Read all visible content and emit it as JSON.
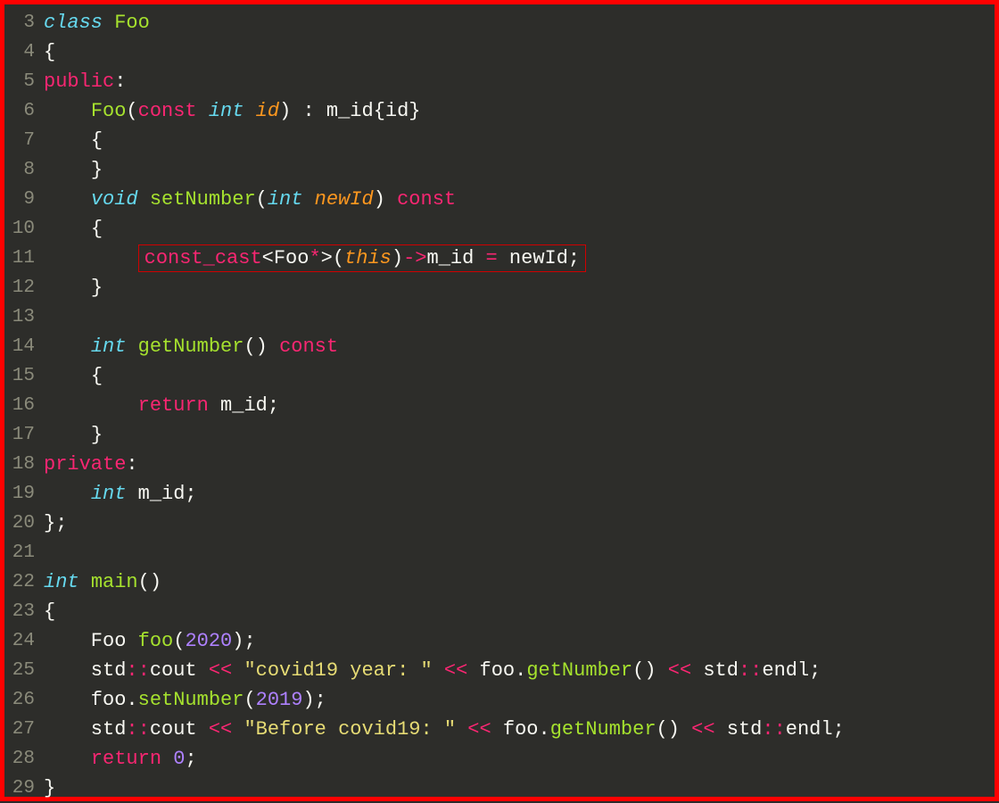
{
  "lines": [
    {
      "num": "3",
      "tokens": [
        [
          "kw-class",
          "class"
        ],
        [
          "ident",
          " "
        ],
        [
          "classname",
          "Foo"
        ]
      ]
    },
    {
      "num": "4",
      "tokens": [
        [
          "punct",
          "{"
        ]
      ]
    },
    {
      "num": "5",
      "tokens": [
        [
          "kw-access",
          "public"
        ],
        [
          "punct",
          ":"
        ]
      ]
    },
    {
      "num": "6",
      "tokens": [
        [
          "ident",
          "    "
        ],
        [
          "funcname",
          "Foo"
        ],
        [
          "punct",
          "("
        ],
        [
          "kw-const",
          "const"
        ],
        [
          "ident",
          " "
        ],
        [
          "kw-type",
          "int"
        ],
        [
          "ident",
          " "
        ],
        [
          "param",
          "id"
        ],
        [
          "punct",
          ") : "
        ],
        [
          "ident",
          "m_id"
        ],
        [
          "punct",
          "{"
        ],
        [
          "ident",
          "id"
        ],
        [
          "punct",
          "}"
        ]
      ]
    },
    {
      "num": "7",
      "tokens": [
        [
          "ident",
          "    "
        ],
        [
          "punct",
          "{"
        ]
      ]
    },
    {
      "num": "8",
      "tokens": [
        [
          "ident",
          "    "
        ],
        [
          "punct",
          "}"
        ]
      ]
    },
    {
      "num": "9",
      "tokens": [
        [
          "ident",
          "    "
        ],
        [
          "kw-type",
          "void"
        ],
        [
          "ident",
          " "
        ],
        [
          "funcname",
          "setNumber"
        ],
        [
          "punct",
          "("
        ],
        [
          "kw-type",
          "int"
        ],
        [
          "ident",
          " "
        ],
        [
          "param",
          "newId"
        ],
        [
          "punct",
          ") "
        ],
        [
          "kw-const",
          "const"
        ]
      ]
    },
    {
      "num": "10",
      "tokens": [
        [
          "ident",
          "    "
        ],
        [
          "punct",
          "{"
        ]
      ]
    },
    {
      "num": "11",
      "highlight": true,
      "prefix": "        ",
      "tokens": [
        [
          "kw-cast",
          "const_cast"
        ],
        [
          "punct",
          "<"
        ],
        [
          "ident",
          "Foo"
        ],
        [
          "op-red",
          "*"
        ],
        [
          "punct",
          ">("
        ],
        [
          "kw-this",
          "this"
        ],
        [
          "punct",
          ")"
        ],
        [
          "op-red",
          "->"
        ],
        [
          "ident",
          "m_id "
        ],
        [
          "op-red",
          "="
        ],
        [
          "ident",
          " newId;"
        ]
      ]
    },
    {
      "num": "12",
      "tokens": [
        [
          "ident",
          "    "
        ],
        [
          "punct",
          "}"
        ]
      ]
    },
    {
      "num": "13",
      "tokens": []
    },
    {
      "num": "14",
      "tokens": [
        [
          "ident",
          "    "
        ],
        [
          "kw-type",
          "int"
        ],
        [
          "ident",
          " "
        ],
        [
          "funcname",
          "getNumber"
        ],
        [
          "punct",
          "() "
        ],
        [
          "kw-const",
          "const"
        ]
      ]
    },
    {
      "num": "15",
      "tokens": [
        [
          "ident",
          "    "
        ],
        [
          "punct",
          "{"
        ]
      ]
    },
    {
      "num": "16",
      "tokens": [
        [
          "ident",
          "        "
        ],
        [
          "kw-return",
          "return"
        ],
        [
          "ident",
          " m_id;"
        ]
      ]
    },
    {
      "num": "17",
      "tokens": [
        [
          "ident",
          "    "
        ],
        [
          "punct",
          "}"
        ]
      ]
    },
    {
      "num": "18",
      "tokens": [
        [
          "kw-access",
          "private"
        ],
        [
          "punct",
          ":"
        ]
      ]
    },
    {
      "num": "19",
      "tokens": [
        [
          "ident",
          "    "
        ],
        [
          "kw-type",
          "int"
        ],
        [
          "ident",
          " m_id;"
        ]
      ]
    },
    {
      "num": "20",
      "tokens": [
        [
          "punct",
          "};"
        ]
      ]
    },
    {
      "num": "21",
      "tokens": []
    },
    {
      "num": "22",
      "tokens": [
        [
          "kw-type",
          "int"
        ],
        [
          "ident",
          " "
        ],
        [
          "funcname",
          "main"
        ],
        [
          "punct",
          "()"
        ]
      ]
    },
    {
      "num": "23",
      "tokens": [
        [
          "punct",
          "{"
        ]
      ]
    },
    {
      "num": "24",
      "tokens": [
        [
          "ident",
          "    Foo "
        ],
        [
          "funcname",
          "foo"
        ],
        [
          "punct",
          "("
        ],
        [
          "num",
          "2020"
        ],
        [
          "punct",
          ");"
        ]
      ]
    },
    {
      "num": "25",
      "tokens": [
        [
          "ident",
          "    std"
        ],
        [
          "op-red",
          "::"
        ],
        [
          "ident",
          "cout "
        ],
        [
          "op-red",
          "<<"
        ],
        [
          "ident",
          " "
        ],
        [
          "str",
          "\"covid19 year: \""
        ],
        [
          "ident",
          " "
        ],
        [
          "op-red",
          "<<"
        ],
        [
          "ident",
          " foo."
        ],
        [
          "funcname",
          "getNumber"
        ],
        [
          "punct",
          "() "
        ],
        [
          "op-red",
          "<<"
        ],
        [
          "ident",
          " std"
        ],
        [
          "op-red",
          "::"
        ],
        [
          "ident",
          "endl;"
        ]
      ]
    },
    {
      "num": "26",
      "tokens": [
        [
          "ident",
          "    foo."
        ],
        [
          "funcname",
          "setNumber"
        ],
        [
          "punct",
          "("
        ],
        [
          "num",
          "2019"
        ],
        [
          "punct",
          ");"
        ]
      ]
    },
    {
      "num": "27",
      "tokens": [
        [
          "ident",
          "    std"
        ],
        [
          "op-red",
          "::"
        ],
        [
          "ident",
          "cout "
        ],
        [
          "op-red",
          "<<"
        ],
        [
          "ident",
          " "
        ],
        [
          "str",
          "\"Before covid19: \""
        ],
        [
          "ident",
          " "
        ],
        [
          "op-red",
          "<<"
        ],
        [
          "ident",
          " foo."
        ],
        [
          "funcname",
          "getNumber"
        ],
        [
          "punct",
          "() "
        ],
        [
          "op-red",
          "<<"
        ],
        [
          "ident",
          " std"
        ],
        [
          "op-red",
          "::"
        ],
        [
          "ident",
          "endl;"
        ]
      ]
    },
    {
      "num": "28",
      "tokens": [
        [
          "ident",
          "    "
        ],
        [
          "kw-return",
          "return"
        ],
        [
          "ident",
          " "
        ],
        [
          "num",
          "0"
        ],
        [
          "punct",
          ";"
        ]
      ]
    },
    {
      "num": "29",
      "tokens": [
        [
          "punct",
          "}"
        ]
      ]
    }
  ]
}
